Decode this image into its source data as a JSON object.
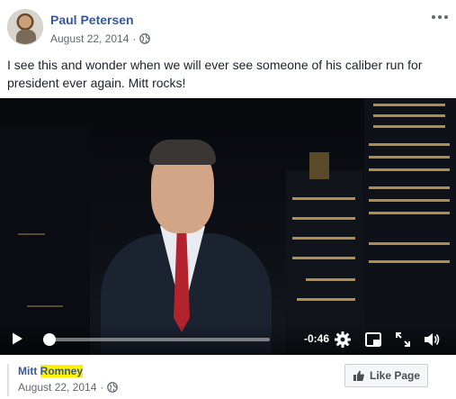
{
  "post": {
    "author": "Paul Petersen",
    "date": "August 22, 2014",
    "separator": "·",
    "text": "I see this and wonder when we will ever see someone of his caliber run for president ever again. Mitt rocks!"
  },
  "video": {
    "time_remaining": "-0:46",
    "progress_fraction": 0.0
  },
  "page": {
    "name_prefix": "Mitt ",
    "name_highlight": "Romney",
    "date": "August 22, 2014",
    "separator": "·",
    "like_button_label": "Like Page"
  },
  "icons": {
    "privacy": "globe-icon",
    "more": "more-options-icon",
    "play": "play-icon",
    "settings": "gear-icon",
    "pip": "picture-in-picture-icon",
    "fullscreen": "fullscreen-icon",
    "volume": "volume-icon",
    "like": "thumbs-up-icon"
  },
  "colors": {
    "link": "#385898",
    "meta": "#616770",
    "highlight": "#fff200"
  }
}
